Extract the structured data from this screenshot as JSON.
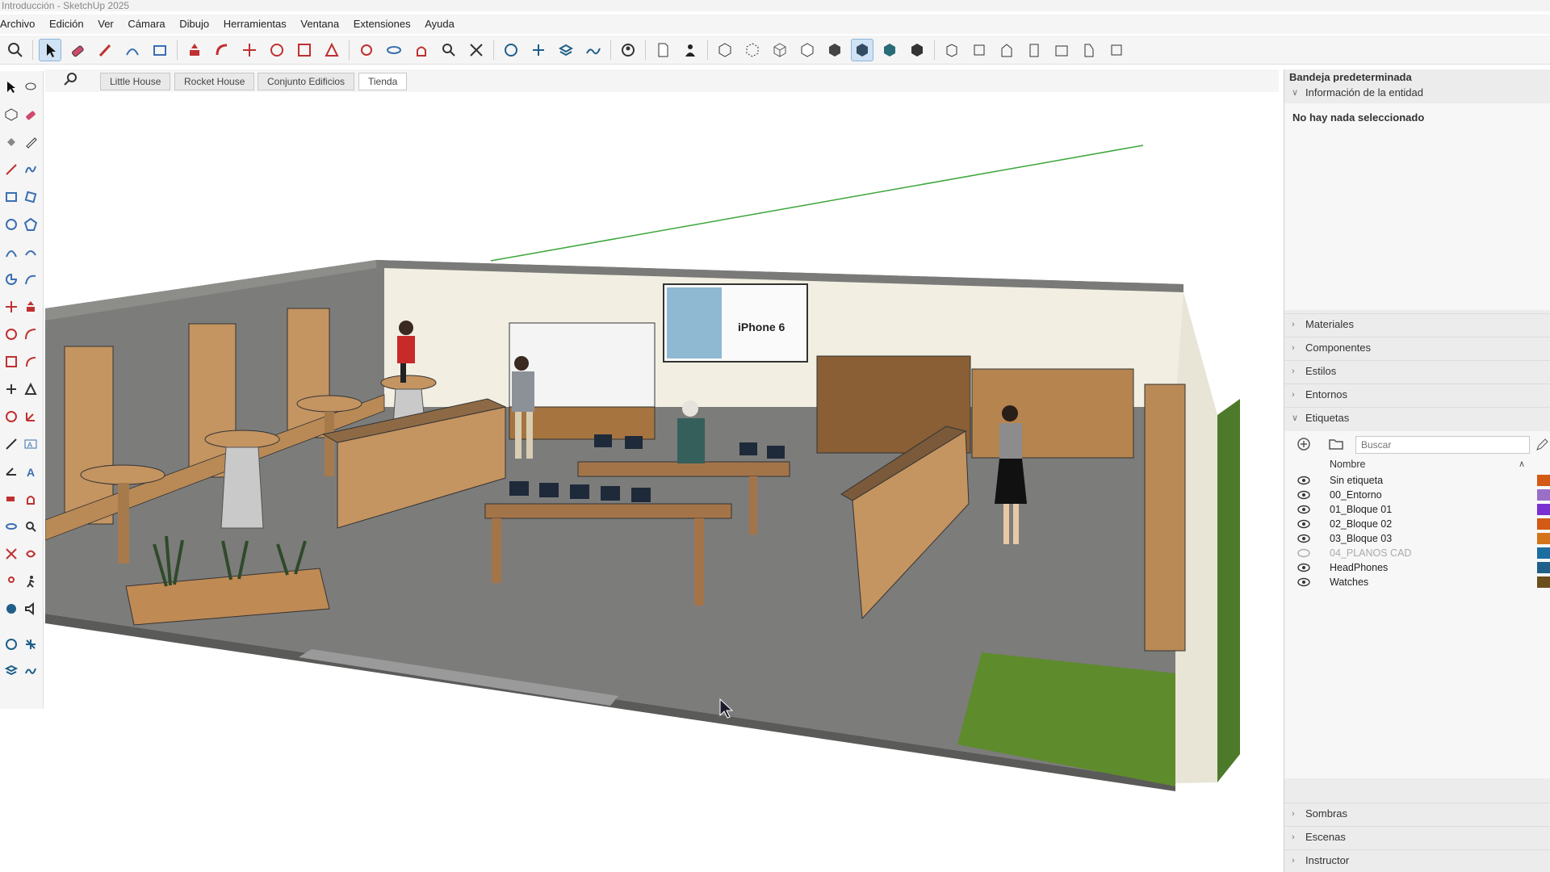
{
  "window": {
    "title": "Introducción - SketchUp 2025"
  },
  "menu": [
    "Archivo",
    "Edición",
    "Ver",
    "Cámara",
    "Dibujo",
    "Herramientas",
    "Ventana",
    "Extensiones",
    "Ayuda"
  ],
  "scene_tabs": [
    {
      "label": "Little House",
      "active": false
    },
    {
      "label": "Rocket House",
      "active": false
    },
    {
      "label": "Conjunto Edificios",
      "active": false
    },
    {
      "label": "Tienda",
      "active": true
    }
  ],
  "viewport": {
    "poster_text": "iPhone 6"
  },
  "tray": {
    "title": "Bandeja predeterminada",
    "entity_info": {
      "label": "Información de la entidad",
      "message": "No hay nada seleccionado"
    },
    "panels_top": [
      "Materiales",
      "Componentes",
      "Estilos",
      "Entornos"
    ],
    "tags": {
      "label": "Etiquetas",
      "search_placeholder": "Buscar",
      "column_name": "Nombre",
      "rows": [
        {
          "name": "Sin etiqueta",
          "visible": true,
          "color": "#d25a14"
        },
        {
          "name": "00_Entorno",
          "visible": true,
          "color": "#9a6fc8"
        },
        {
          "name": "01_Bloque 01",
          "visible": true,
          "color": "#7a2fd2"
        },
        {
          "name": "02_Bloque 02",
          "visible": true,
          "color": "#d25a14"
        },
        {
          "name": "03_Bloque 03",
          "visible": true,
          "color": "#d2751a"
        },
        {
          "name": "04_PLANOS CAD",
          "visible": false,
          "color": "#1d6ea0"
        },
        {
          "name": "HeadPhones",
          "visible": true,
          "color": "#1f5f8a"
        },
        {
          "name": "Watches",
          "visible": true,
          "color": "#6b4e1c"
        }
      ]
    },
    "panels_bottom": [
      "Sombras",
      "Escenas",
      "Instructor"
    ]
  }
}
